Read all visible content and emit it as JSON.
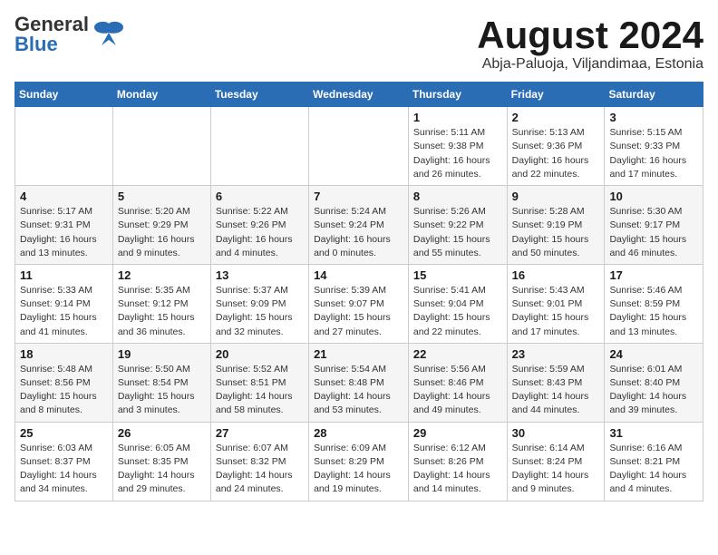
{
  "header": {
    "logo_general": "General",
    "logo_blue": "Blue",
    "month_year": "August 2024",
    "location": "Abja-Paluoja, Viljandimaa, Estonia"
  },
  "weekdays": [
    "Sunday",
    "Monday",
    "Tuesday",
    "Wednesday",
    "Thursday",
    "Friday",
    "Saturday"
  ],
  "weeks": [
    [
      {
        "day": "",
        "info": ""
      },
      {
        "day": "",
        "info": ""
      },
      {
        "day": "",
        "info": ""
      },
      {
        "day": "",
        "info": ""
      },
      {
        "day": "1",
        "info": "Sunrise: 5:11 AM\nSunset: 9:38 PM\nDaylight: 16 hours\nand 26 minutes."
      },
      {
        "day": "2",
        "info": "Sunrise: 5:13 AM\nSunset: 9:36 PM\nDaylight: 16 hours\nand 22 minutes."
      },
      {
        "day": "3",
        "info": "Sunrise: 5:15 AM\nSunset: 9:33 PM\nDaylight: 16 hours\nand 17 minutes."
      }
    ],
    [
      {
        "day": "4",
        "info": "Sunrise: 5:17 AM\nSunset: 9:31 PM\nDaylight: 16 hours\nand 13 minutes."
      },
      {
        "day": "5",
        "info": "Sunrise: 5:20 AM\nSunset: 9:29 PM\nDaylight: 16 hours\nand 9 minutes."
      },
      {
        "day": "6",
        "info": "Sunrise: 5:22 AM\nSunset: 9:26 PM\nDaylight: 16 hours\nand 4 minutes."
      },
      {
        "day": "7",
        "info": "Sunrise: 5:24 AM\nSunset: 9:24 PM\nDaylight: 16 hours\nand 0 minutes."
      },
      {
        "day": "8",
        "info": "Sunrise: 5:26 AM\nSunset: 9:22 PM\nDaylight: 15 hours\nand 55 minutes."
      },
      {
        "day": "9",
        "info": "Sunrise: 5:28 AM\nSunset: 9:19 PM\nDaylight: 15 hours\nand 50 minutes."
      },
      {
        "day": "10",
        "info": "Sunrise: 5:30 AM\nSunset: 9:17 PM\nDaylight: 15 hours\nand 46 minutes."
      }
    ],
    [
      {
        "day": "11",
        "info": "Sunrise: 5:33 AM\nSunset: 9:14 PM\nDaylight: 15 hours\nand 41 minutes."
      },
      {
        "day": "12",
        "info": "Sunrise: 5:35 AM\nSunset: 9:12 PM\nDaylight: 15 hours\nand 36 minutes."
      },
      {
        "day": "13",
        "info": "Sunrise: 5:37 AM\nSunset: 9:09 PM\nDaylight: 15 hours\nand 32 minutes."
      },
      {
        "day": "14",
        "info": "Sunrise: 5:39 AM\nSunset: 9:07 PM\nDaylight: 15 hours\nand 27 minutes."
      },
      {
        "day": "15",
        "info": "Sunrise: 5:41 AM\nSunset: 9:04 PM\nDaylight: 15 hours\nand 22 minutes."
      },
      {
        "day": "16",
        "info": "Sunrise: 5:43 AM\nSunset: 9:01 PM\nDaylight: 15 hours\nand 17 minutes."
      },
      {
        "day": "17",
        "info": "Sunrise: 5:46 AM\nSunset: 8:59 PM\nDaylight: 15 hours\nand 13 minutes."
      }
    ],
    [
      {
        "day": "18",
        "info": "Sunrise: 5:48 AM\nSunset: 8:56 PM\nDaylight: 15 hours\nand 8 minutes."
      },
      {
        "day": "19",
        "info": "Sunrise: 5:50 AM\nSunset: 8:54 PM\nDaylight: 15 hours\nand 3 minutes."
      },
      {
        "day": "20",
        "info": "Sunrise: 5:52 AM\nSunset: 8:51 PM\nDaylight: 14 hours\nand 58 minutes."
      },
      {
        "day": "21",
        "info": "Sunrise: 5:54 AM\nSunset: 8:48 PM\nDaylight: 14 hours\nand 53 minutes."
      },
      {
        "day": "22",
        "info": "Sunrise: 5:56 AM\nSunset: 8:46 PM\nDaylight: 14 hours\nand 49 minutes."
      },
      {
        "day": "23",
        "info": "Sunrise: 5:59 AM\nSunset: 8:43 PM\nDaylight: 14 hours\nand 44 minutes."
      },
      {
        "day": "24",
        "info": "Sunrise: 6:01 AM\nSunset: 8:40 PM\nDaylight: 14 hours\nand 39 minutes."
      }
    ],
    [
      {
        "day": "25",
        "info": "Sunrise: 6:03 AM\nSunset: 8:37 PM\nDaylight: 14 hours\nand 34 minutes."
      },
      {
        "day": "26",
        "info": "Sunrise: 6:05 AM\nSunset: 8:35 PM\nDaylight: 14 hours\nand 29 minutes."
      },
      {
        "day": "27",
        "info": "Sunrise: 6:07 AM\nSunset: 8:32 PM\nDaylight: 14 hours\nand 24 minutes."
      },
      {
        "day": "28",
        "info": "Sunrise: 6:09 AM\nSunset: 8:29 PM\nDaylight: 14 hours\nand 19 minutes."
      },
      {
        "day": "29",
        "info": "Sunrise: 6:12 AM\nSunset: 8:26 PM\nDaylight: 14 hours\nand 14 minutes."
      },
      {
        "day": "30",
        "info": "Sunrise: 6:14 AM\nSunset: 8:24 PM\nDaylight: 14 hours\nand 9 minutes."
      },
      {
        "day": "31",
        "info": "Sunrise: 6:16 AM\nSunset: 8:21 PM\nDaylight: 14 hours\nand 4 minutes."
      }
    ]
  ]
}
